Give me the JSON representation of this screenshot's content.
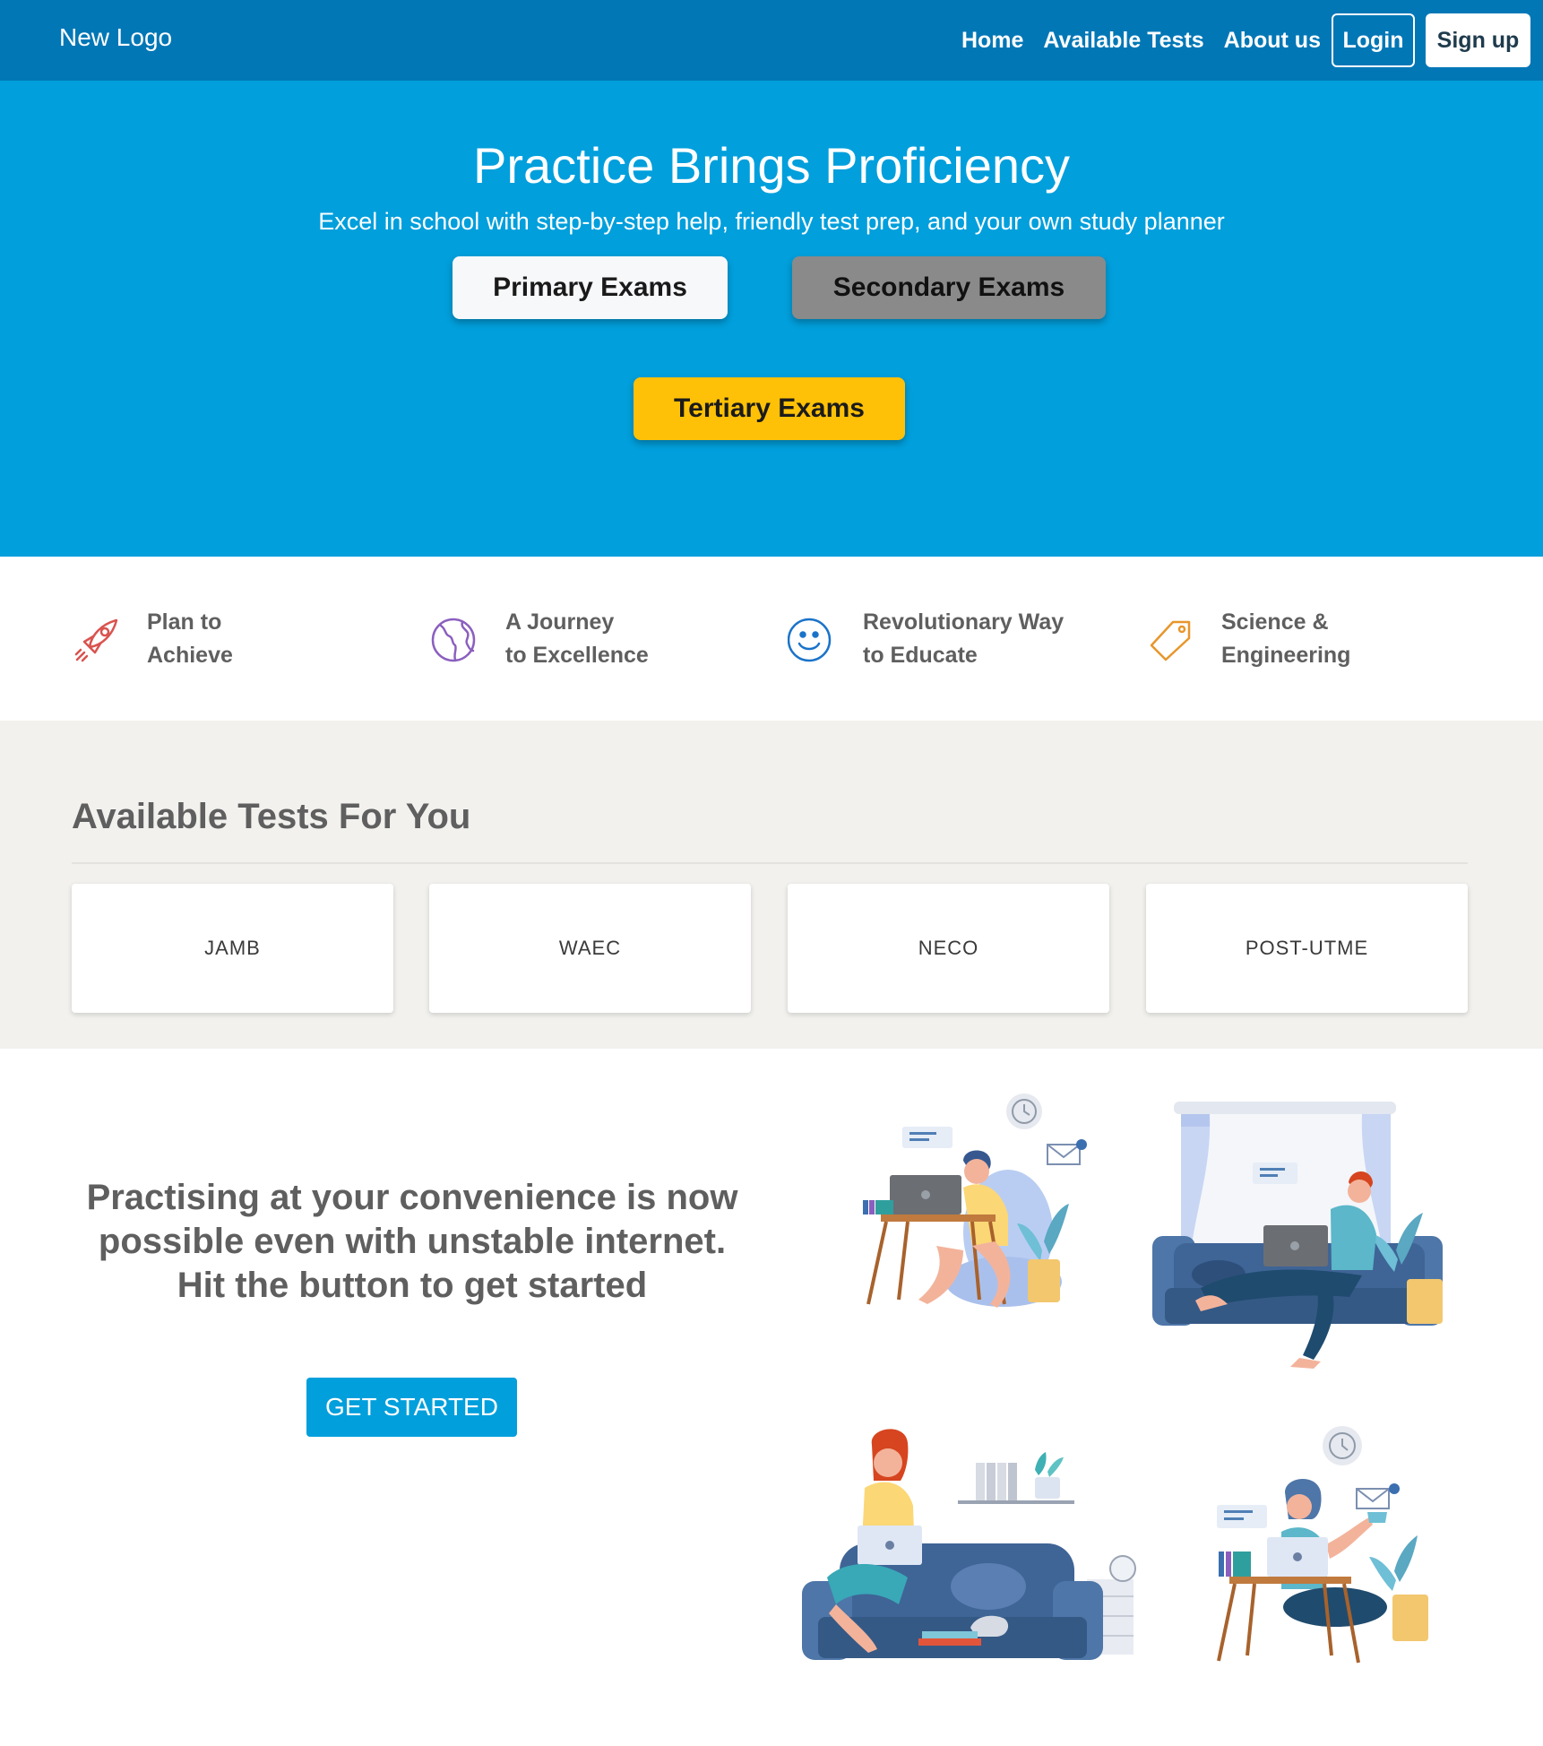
{
  "navbar": {
    "logo": "New Logo",
    "links": [
      "Home",
      "Available Tests",
      "About us"
    ],
    "login": "Login",
    "signup": "Sign up"
  },
  "hero": {
    "title": "Practice Brings Proficiency",
    "subtitle": "Excel in school with step-by-step help, friendly test prep, and your own study planner",
    "buttons": {
      "primary": "Primary Exams",
      "secondary": "Secondary Exams",
      "tertiary": "Tertiary Exams"
    }
  },
  "features": [
    {
      "line1": "Plan to",
      "line2": "Achieve",
      "icon": "rocket-icon"
    },
    {
      "line1": "A Journey",
      "line2": "to Excellence",
      "icon": "globe-icon"
    },
    {
      "line1": "Revolutionary Way",
      "line2": "to Educate",
      "icon": "smiley-icon"
    },
    {
      "line1": "Science &",
      "line2": "Engineering",
      "icon": "tag-icon"
    }
  ],
  "tests": {
    "title": "Available Tests For You",
    "items": [
      "JAMB",
      "WAEC",
      "NECO",
      "POST-UTME"
    ]
  },
  "promo": {
    "line1": "Practising at your convenience is now",
    "line2": "possible even with unstable internet.",
    "line3": "Hit the button to get started",
    "button": "GET STARTED"
  },
  "colors": {
    "nav": "#0277b6",
    "hero": "#019fdc",
    "tertiary": "#ffc107",
    "secondary": "#8a8a8a",
    "tests_bg": "#f2f1ee"
  }
}
